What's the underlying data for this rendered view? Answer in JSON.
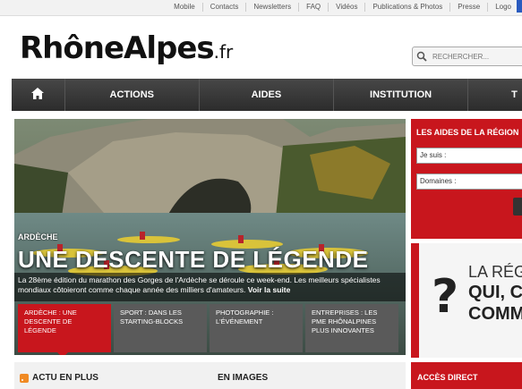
{
  "utility": {
    "links": [
      "Mobile",
      "Contacts",
      "Newsletters",
      "FAQ",
      "Vidéos",
      "Publications & Photos",
      "Presse",
      "Logo"
    ]
  },
  "header": {
    "logo_main": "RhôneAlpes",
    "logo_tld": ".fr",
    "search_placeholder": "RECHERCHER..."
  },
  "nav": {
    "items": [
      "ACTIONS",
      "AIDES",
      "INSTITUTION",
      "T"
    ]
  },
  "hero": {
    "region": "ARDÈCHE",
    "headline": "UNE DESCENTE DE LÉGENDE",
    "description": "La 28ème édition du marathon des Gorges de l'Ardèche se déroule ce week-end. Les meilleurs spécialistes mondiaux côtoieront comme chaque année des milliers d'amateurs.",
    "read_more": "Voir la suite",
    "tiles": [
      "ARDÈCHE : UNE DESCENTE DE LÉGENDE",
      "SPORT : DANS LES STARTING-BLOCKS",
      "PHOTOGRAPHIE : L'ÉVÉNEMENT",
      "ENTREPRISES : LES PME RHÔNALPINES PLUS INNOVANTES"
    ]
  },
  "sections": {
    "actu": "ACTU EN PLUS",
    "images": "EN IMAGES"
  },
  "aides": {
    "title": "LES AIDES DE LA RÉGION",
    "field1": "Je suis :",
    "field2": "Domaines :"
  },
  "promo": {
    "q": "?",
    "line1": "LA RÉG",
    "line2": "QUI, C",
    "line3": "COMM"
  },
  "acces": {
    "title": "ACCÈS DIRECT"
  },
  "colors": {
    "accent": "#c8161d",
    "nav": "#333333",
    "tile": "#5a5a5a",
    "rss": "#f08a24"
  }
}
